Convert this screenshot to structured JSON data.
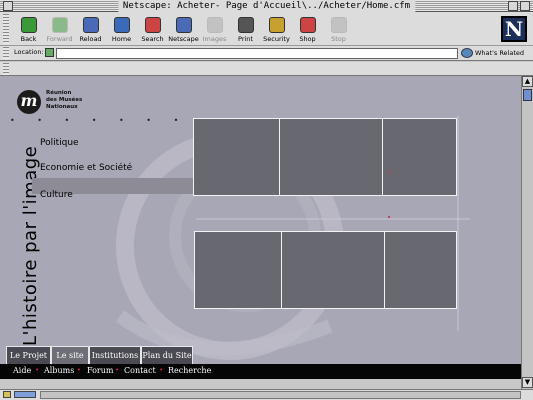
{
  "window": {
    "title": "Netscape: Acheter- Page d'Accueil\\../Acheter/Home.cfm"
  },
  "toolbar": {
    "buttons": [
      {
        "label": "Back",
        "icon": "back-arrow-icon",
        "enabled": true
      },
      {
        "label": "Forward",
        "icon": "forward-arrow-icon",
        "enabled": false
      },
      {
        "label": "Reload",
        "icon": "reload-icon",
        "enabled": true
      },
      {
        "label": "Home",
        "icon": "home-icon",
        "enabled": true
      },
      {
        "label": "Search",
        "icon": "search-icon",
        "enabled": true
      },
      {
        "label": "Netscape",
        "icon": "netscape-icon",
        "enabled": true
      },
      {
        "label": "Images",
        "icon": "images-icon",
        "enabled": false
      },
      {
        "label": "Print",
        "icon": "print-icon",
        "enabled": true
      },
      {
        "label": "Security",
        "icon": "security-icon",
        "enabled": true
      },
      {
        "label": "Shop",
        "icon": "shop-icon",
        "enabled": true
      },
      {
        "label": "Stop",
        "icon": "stop-icon",
        "enabled": false
      }
    ],
    "logo": "N"
  },
  "location": {
    "label": "Location:",
    "value": "",
    "related_label": "What's Related"
  },
  "site": {
    "logo_letter": "m",
    "logo_lines": [
      "Réunion",
      "des Musées",
      "Nationaux"
    ],
    "logo_dots": "• • • • • • •",
    "vertical_title": "L'histoire par l'image",
    "menu": [
      "Politique",
      "Economie et Société",
      "Culture"
    ],
    "tabs": [
      "Le Projet",
      "Le site",
      "Institutions",
      "Plan du Site"
    ],
    "footer_links": [
      "Aide",
      "Albums",
      "Forum",
      "Contact",
      "Recherche"
    ],
    "footer_separator": "•"
  },
  "colors": {
    "content_bg": "#a8a7b5",
    "panel": "#686870",
    "accent_red": "#d21f3a"
  }
}
